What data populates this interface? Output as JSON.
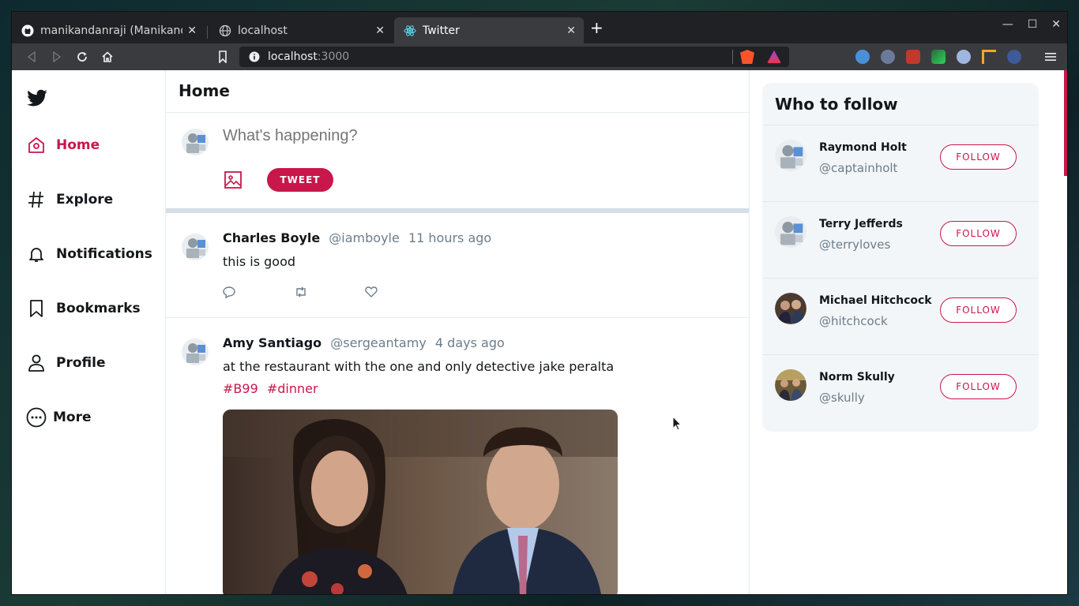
{
  "browser": {
    "tabs": [
      {
        "title": "manikandanraji (Manikandan Raji)"
      },
      {
        "title": "localhost"
      },
      {
        "title": "Twitter"
      }
    ],
    "url_host": "localhost",
    "url_port": ":3000"
  },
  "sidebar": {
    "items": [
      {
        "label": "Home"
      },
      {
        "label": "Explore"
      },
      {
        "label": "Notifications"
      },
      {
        "label": "Bookmarks"
      },
      {
        "label": "Profile"
      },
      {
        "label": "More"
      }
    ]
  },
  "feed": {
    "title": "Home",
    "compose_placeholder": "What's happening?",
    "tweet_button": "TWEET"
  },
  "tweets": [
    {
      "name": "Charles Boyle",
      "handle": "@iamboyle",
      "time": "11 hours ago",
      "text": "this is good"
    },
    {
      "name": "Amy Santiago",
      "handle": "@sergeantamy",
      "time": "4 days ago",
      "text": "at the restaurant with the one and only detective jake peralta",
      "hashtags": [
        "#B99",
        "#dinner"
      ]
    }
  ],
  "who_to_follow": {
    "title": "Who to follow",
    "follow_label": "FOLLOW",
    "users": [
      {
        "name": "Raymond Holt",
        "handle": "@captainholt"
      },
      {
        "name": "Terry Jefferds",
        "handle": "@terryloves"
      },
      {
        "name": "Michael Hitchcock",
        "handle": "@hitchcock"
      },
      {
        "name": "Norm Skully",
        "handle": "@skully"
      }
    ]
  },
  "colors": {
    "accent": "#c8174a",
    "text": "#14171a",
    "muted": "#6b7d8c"
  }
}
